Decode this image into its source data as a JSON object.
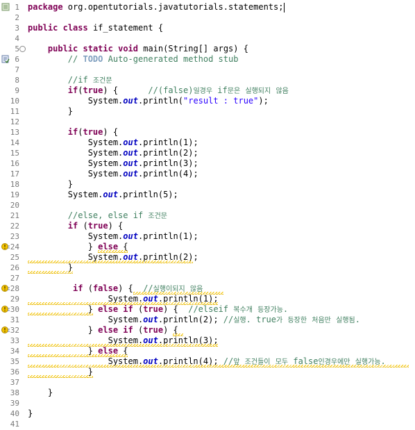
{
  "editor": {
    "lines": [
      {
        "n": "1",
        "t": "package org.opentutorials.javatutorials.statements;"
      },
      {
        "n": "2",
        "t": ""
      },
      {
        "n": "3",
        "t": "public class if_statement {"
      },
      {
        "n": "4",
        "t": ""
      },
      {
        "n": "5",
        "t": "    public static void main(String[] args) {"
      },
      {
        "n": "6",
        "t": "        // TODO Auto-generated method stub"
      },
      {
        "n": "7",
        "t": ""
      },
      {
        "n": "8",
        "t": "        //if 조건문"
      },
      {
        "n": "9",
        "t": "        if(true) {      //(false)일경우 if문은 실행되지 않음"
      },
      {
        "n": "10",
        "t": "            System.out.println(\"result : true\");"
      },
      {
        "n": "11",
        "t": "        }"
      },
      {
        "n": "12",
        "t": ""
      },
      {
        "n": "13",
        "t": "        if(true) {"
      },
      {
        "n": "14",
        "t": "            System.out.println(1);"
      },
      {
        "n": "15",
        "t": "            System.out.println(2);"
      },
      {
        "n": "16",
        "t": "            System.out.println(3);"
      },
      {
        "n": "17",
        "t": "            System.out.println(4);"
      },
      {
        "n": "18",
        "t": "        }"
      },
      {
        "n": "19",
        "t": "        System.out.println(5);"
      },
      {
        "n": "20",
        "t": ""
      },
      {
        "n": "21",
        "t": "        //else, else if 조건문"
      },
      {
        "n": "22",
        "t": "        if (true) {"
      },
      {
        "n": "23",
        "t": "            System.out.println(1);"
      },
      {
        "n": "24",
        "t": "            } else {"
      },
      {
        "n": "25",
        "t": "            System.out.println(2);"
      },
      {
        "n": "26",
        "t": "        }"
      },
      {
        "n": "27",
        "t": ""
      },
      {
        "n": "28",
        "t": "         if (false) {  //실행이되지 않음"
      },
      {
        "n": "29",
        "t": "                System.out.println(1);"
      },
      {
        "n": "30",
        "t": "            } else if (true) {  //elseif 복수개 등장가능."
      },
      {
        "n": "31",
        "t": "                System.out.println(2); //실행. true가 등장한 처음만 실행됨."
      },
      {
        "n": "32",
        "t": "            } else if (true) {"
      },
      {
        "n": "33",
        "t": "                System.out.println(3);"
      },
      {
        "n": "34",
        "t": "            } else {"
      },
      {
        "n": "35",
        "t": "                System.out.println(4); //앞 조건들이 모두 false인경우에만 실행가능."
      },
      {
        "n": "36",
        "t": "            }"
      },
      {
        "n": "37",
        "t": ""
      },
      {
        "n": "38",
        "t": "    }"
      },
      {
        "n": "39",
        "t": ""
      },
      {
        "n": "40",
        "t": "}"
      },
      {
        "n": "41",
        "t": ""
      }
    ],
    "fold_marker": "⊖",
    "colors": {
      "keyword": "#7f0055",
      "comment": "#3f7f5f",
      "string": "#2a00ff",
      "field": "#0000c0",
      "line_number": "#787878",
      "warning": "#f4c400"
    }
  }
}
